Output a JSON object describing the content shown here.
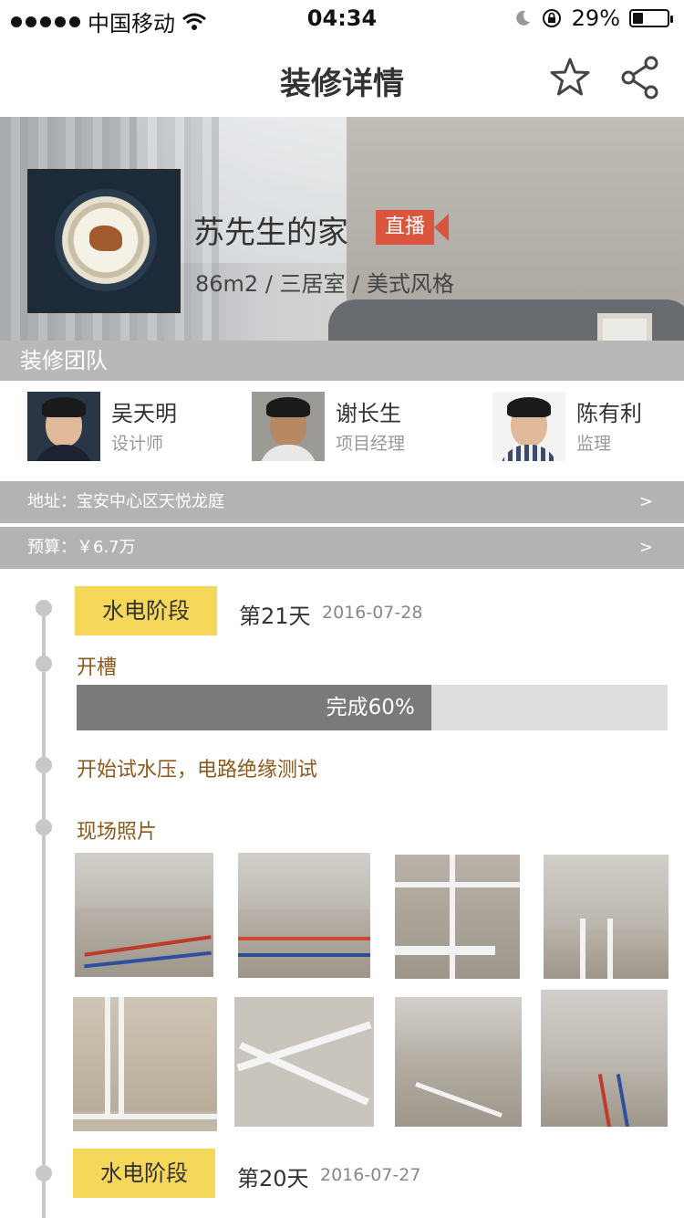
{
  "status_bar": {
    "carrier": "中国移动",
    "time": "04:34",
    "battery": "29%",
    "battery_level": 0.29
  },
  "nav": {
    "title": "装修详情",
    "icons": [
      "star-icon",
      "share-icon"
    ]
  },
  "project": {
    "name": "苏先生的家",
    "live_badge": "直播",
    "info": "86m2 / 三居室 / 美式风格"
  },
  "team": {
    "heading": "装修团队",
    "members": [
      {
        "name": "吴天明",
        "role": "设计师"
      },
      {
        "name": "谢长生",
        "role": "项目经理"
      },
      {
        "name": "陈有利",
        "role": "监理"
      }
    ]
  },
  "address": {
    "label": "地址：宝安中心区天悦龙庭",
    "arrow": ">"
  },
  "budget": {
    "label": "预算：￥6.7万",
    "arrow": ">"
  },
  "timeline": {
    "stage1": {
      "badge": "水电阶段",
      "day": "第21天",
      "date": "2016-07-28"
    },
    "task": {
      "name": "开槽",
      "progress_label": "完成60%",
      "progress": 0.6
    },
    "test": "开始试水压，电路绝缘测试",
    "photos_title": "现场照片",
    "stage2": {
      "badge": "水电阶段",
      "day": "第20天",
      "date": "2016-07-27"
    }
  },
  "colors": {
    "stage_badge": "#f5d75a",
    "live_badge": "#d9553e",
    "task_text": "#8a5a1e",
    "section_bar": "#b3b3b3"
  }
}
